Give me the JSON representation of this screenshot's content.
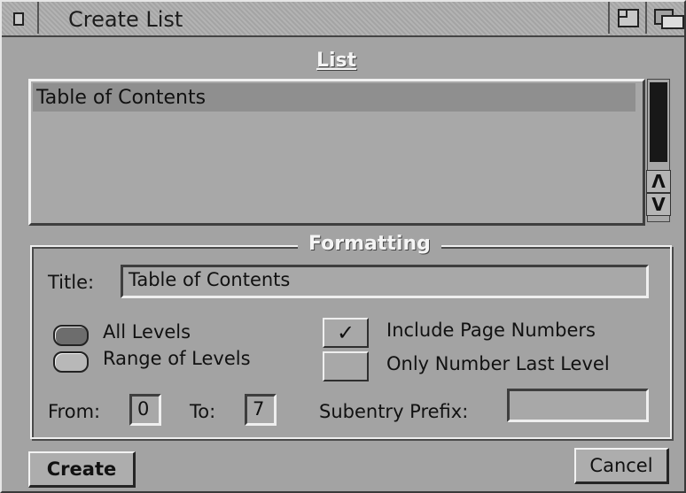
{
  "window": {
    "title": "Create List"
  },
  "list": {
    "heading": "List",
    "items": [
      "Table of Contents"
    ],
    "scroll_up": "Λ",
    "scroll_down": "V"
  },
  "formatting": {
    "heading": "Formatting",
    "title_label": "Title:",
    "title_value": "Table of Contents",
    "radio_all": "All Levels",
    "radio_range": "Range of Levels",
    "selected_radio": "All Levels",
    "include_page_numbers": {
      "label": "Include Page Numbers",
      "checked": true,
      "mark": "✓"
    },
    "only_last_level": {
      "label": "Only Number Last Level",
      "checked": false
    },
    "from_label": "From:",
    "from_value": "0",
    "to_label": "To:",
    "to_value": "7",
    "subentry_label": "Subentry Prefix:",
    "subentry_value": ""
  },
  "buttons": {
    "create": "Create",
    "cancel": "Cancel"
  },
  "colors": {
    "window_bg": "#a3a3a3",
    "selection": "#8f8f8f",
    "scroll_thumb": "#181818"
  }
}
